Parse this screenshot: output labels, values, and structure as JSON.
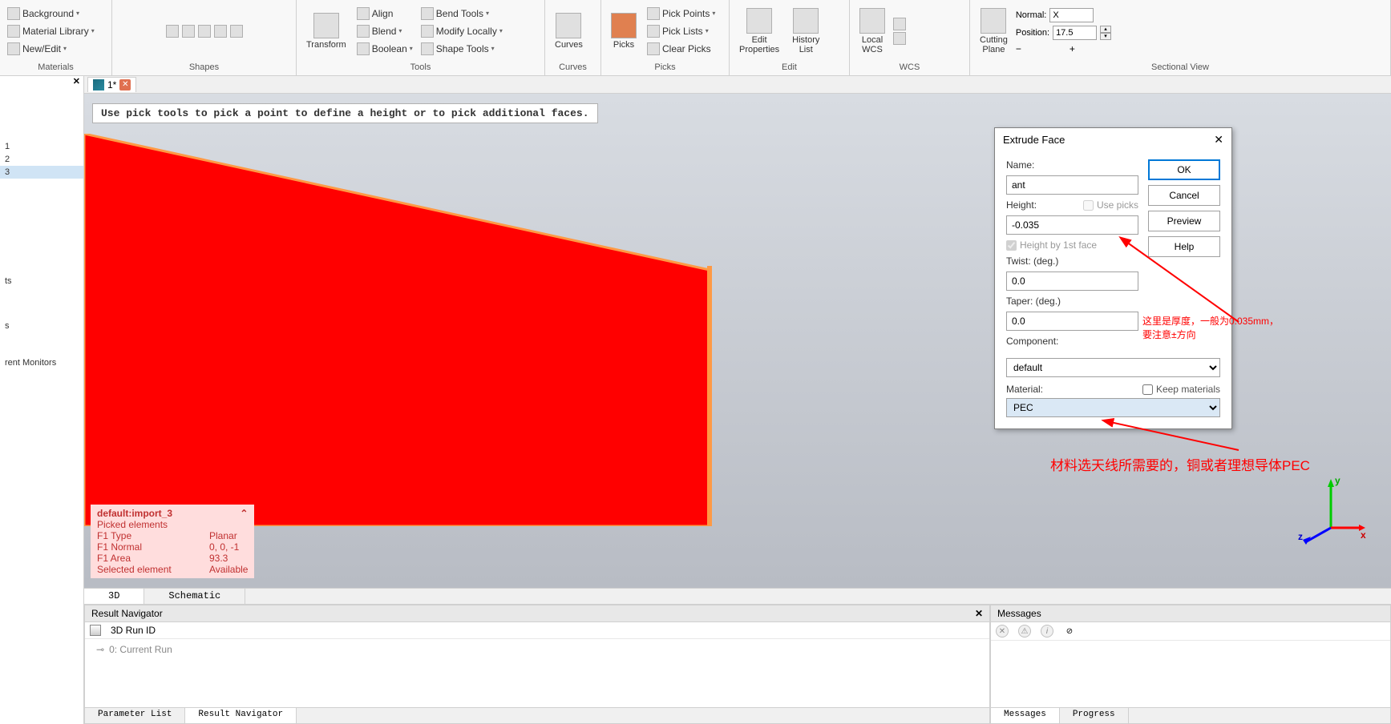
{
  "ribbon": {
    "materials": {
      "background": "Background",
      "library": "Material Library",
      "newedit": "New/Edit",
      "group": "Materials"
    },
    "shapes": {
      "group": "Shapes"
    },
    "tools": {
      "transform": "Transform",
      "align": "Align",
      "blend": "Blend",
      "boolean": "Boolean",
      "bendtools": "Bend Tools",
      "modifylocally": "Modify Locally",
      "shapetools": "Shape Tools",
      "group": "Tools"
    },
    "curves": {
      "curves": "Curves",
      "group": "Curves"
    },
    "picks": {
      "picks": "Picks",
      "pickpoints": "Pick Points",
      "picklists": "Pick Lists",
      "clearpicks": "Clear Picks",
      "group": "Picks"
    },
    "edit": {
      "properties": "Edit\nProperties",
      "history": "History\nList",
      "group": "Edit"
    },
    "wcs": {
      "local": "Local\nWCS",
      "group": "WCS"
    },
    "sectional": {
      "cutting": "Cutting\nPlane",
      "normal_label": "Normal:",
      "normal_value": "X",
      "position_label": "Position:",
      "position_value": "17.5",
      "group": "Sectional View"
    }
  },
  "left_tree": {
    "items": [
      "1",
      "2",
      "3",
      "ts",
      "s",
      "rent Monitors"
    ]
  },
  "tab": {
    "label": "1*"
  },
  "viewport": {
    "hint": "Use pick tools to pick a point to define a height or to pick additional faces.",
    "info_title": "default:import_3",
    "info_picked": "Picked elements",
    "info_rows": [
      {
        "k": "F1 Type",
        "v": "Planar"
      },
      {
        "k": "F1 Normal",
        "v": "0, 0, -1"
      },
      {
        "k": "F1 Area",
        "v": "93.3"
      },
      {
        "k": "Selected element",
        "v": "Available"
      }
    ]
  },
  "dialog": {
    "title": "Extrude Face",
    "name_label": "Name:",
    "name_value": "ant",
    "height_label": "Height:",
    "height_value": "-0.035",
    "usepicks": "Use picks",
    "heightby": "Height by 1st face",
    "twist_label": "Twist: (deg.)",
    "twist_value": "0.0",
    "taper_label": "Taper: (deg.)",
    "taper_value": "0.0",
    "component_label": "Component:",
    "component_value": "default",
    "material_label": "Material:",
    "material_value": "PEC",
    "keepmat": "Keep materials",
    "ok": "OK",
    "cancel": "Cancel",
    "preview": "Preview",
    "help": "Help"
  },
  "annotations": {
    "a1_line1": "这里是厚度，一般为0.035mm，",
    "a1_line2": "要注意±方向",
    "a2": "材料选天线所需要的，铜或者理想导体PEC"
  },
  "bottom_tabs_3d": {
    "t1": "3D",
    "t2": "Schematic"
  },
  "result_nav": {
    "title": "Result Navigator",
    "runid": "3D Run ID",
    "current": "0: Current Run"
  },
  "messages": {
    "title": "Messages"
  },
  "bottom_tabs_left": {
    "t1": "Parameter List",
    "t2": "Result Navigator"
  },
  "bottom_tabs_right": {
    "t1": "Messages",
    "t2": "Progress"
  },
  "axes": {
    "x": "x",
    "y": "y",
    "z": "z"
  }
}
